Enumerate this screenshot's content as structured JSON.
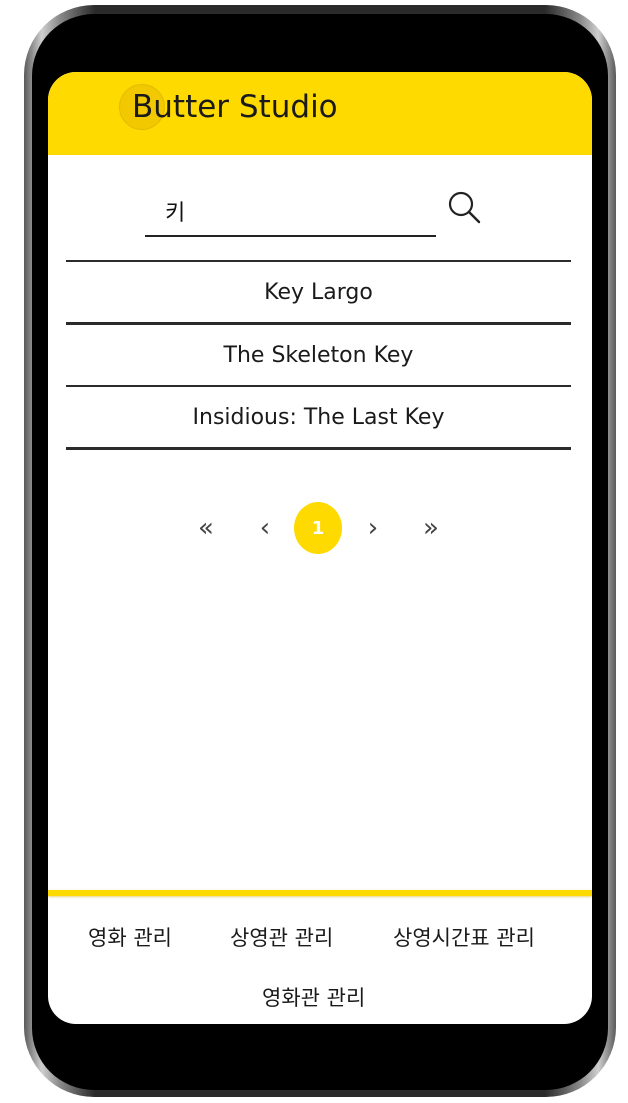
{
  "app": {
    "logo_letter": "B",
    "name_rest": "utter Studio"
  },
  "search": {
    "query": "키",
    "icon": "search-icon"
  },
  "results": [
    "Key Largo",
    "The Skeleton Key",
    "Insidious: The Last Key"
  ],
  "pagination": {
    "first": "«",
    "prev": "‹",
    "current": "1",
    "next": "›",
    "last": "»"
  },
  "footer": {
    "movie_mgmt": "영화 관리",
    "screen_mgmt": "상영관 관리",
    "schedule_mgmt": "상영시간표 관리",
    "theater_mgmt": "영화관 관리"
  },
  "colors": {
    "accent": "#FFDA00",
    "text": "#1a1a1a"
  }
}
